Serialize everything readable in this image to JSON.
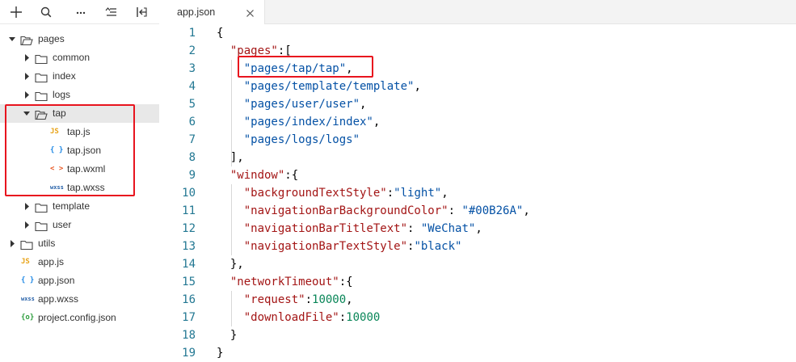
{
  "toolbar": {
    "buttons": [
      {
        "icon": "add-icon"
      },
      {
        "icon": "search-icon"
      },
      {
        "icon": "more-icon"
      },
      {
        "icon": "sort-icon"
      },
      {
        "icon": "collapse-icon"
      }
    ]
  },
  "tree": [
    {
      "label": "pages",
      "type": "folder",
      "expanded": true
    },
    {
      "label": "common",
      "type": "folder",
      "expanded": false
    },
    {
      "label": "index",
      "type": "folder",
      "expanded": false
    },
    {
      "label": "logs",
      "type": "folder",
      "expanded": false
    },
    {
      "label": "tap",
      "type": "folder",
      "expanded": true,
      "selected": true
    },
    {
      "label": "tap.js",
      "type": "file",
      "badge": "JS"
    },
    {
      "label": "tap.json",
      "type": "file",
      "badge": "{ }"
    },
    {
      "label": "tap.wxml",
      "type": "file",
      "badge": "< >"
    },
    {
      "label": "tap.wxss",
      "type": "file",
      "badge": "wxss"
    },
    {
      "label": "template",
      "type": "folder",
      "expanded": false
    },
    {
      "label": "user",
      "type": "folder",
      "expanded": false
    },
    {
      "label": "utils",
      "type": "folder",
      "expanded": false
    },
    {
      "label": "app.js",
      "type": "file",
      "badge": "JS"
    },
    {
      "label": "app.json",
      "type": "file",
      "badge": "{ }"
    },
    {
      "label": "app.wxss",
      "type": "file",
      "badge": "wxss"
    },
    {
      "label": "project.config.json",
      "type": "file",
      "badge": "{o}"
    }
  ],
  "tab": {
    "label": "app.json"
  },
  "code": {
    "line_numbers": [
      "1",
      "2",
      "3",
      "4",
      "5",
      "6",
      "7",
      "8",
      "9",
      "10",
      "11",
      "12",
      "13",
      "14",
      "15",
      "16",
      "17",
      "18",
      "19"
    ],
    "lines": [
      [
        {
          "t": "{",
          "c": "punc"
        }
      ],
      [
        {
          "t": "  ",
          "c": "punc"
        },
        {
          "t": "\"pages\"",
          "c": "key"
        },
        {
          "t": ":[",
          "c": "punc"
        }
      ],
      [
        {
          "t": "    ",
          "c": "punc"
        },
        {
          "t": "\"pages/tap/tap\"",
          "c": "str"
        },
        {
          "t": ",",
          "c": "punc"
        }
      ],
      [
        {
          "t": "    ",
          "c": "punc"
        },
        {
          "t": "\"pages/template/template\"",
          "c": "str"
        },
        {
          "t": ",",
          "c": "punc"
        }
      ],
      [
        {
          "t": "    ",
          "c": "punc"
        },
        {
          "t": "\"pages/user/user\"",
          "c": "str"
        },
        {
          "t": ",",
          "c": "punc"
        }
      ],
      [
        {
          "t": "    ",
          "c": "punc"
        },
        {
          "t": "\"pages/index/index\"",
          "c": "str"
        },
        {
          "t": ",",
          "c": "punc"
        }
      ],
      [
        {
          "t": "    ",
          "c": "punc"
        },
        {
          "t": "\"pages/logs/logs\"",
          "c": "str"
        }
      ],
      [
        {
          "t": "  ],",
          "c": "punc"
        }
      ],
      [
        {
          "t": "  ",
          "c": "punc"
        },
        {
          "t": "\"window\"",
          "c": "key"
        },
        {
          "t": ":{",
          "c": "punc"
        }
      ],
      [
        {
          "t": "    ",
          "c": "punc"
        },
        {
          "t": "\"backgroundTextStyle\"",
          "c": "key"
        },
        {
          "t": ":",
          "c": "punc"
        },
        {
          "t": "\"light\"",
          "c": "str"
        },
        {
          "t": ",",
          "c": "punc"
        }
      ],
      [
        {
          "t": "    ",
          "c": "punc"
        },
        {
          "t": "\"navigationBarBackgroundColor\"",
          "c": "key"
        },
        {
          "t": ": ",
          "c": "punc"
        },
        {
          "t": "\"#00B26A\"",
          "c": "str"
        },
        {
          "t": ",",
          "c": "punc"
        }
      ],
      [
        {
          "t": "    ",
          "c": "punc"
        },
        {
          "t": "\"navigationBarTitleText\"",
          "c": "key"
        },
        {
          "t": ": ",
          "c": "punc"
        },
        {
          "t": "\"WeChat\"",
          "c": "str"
        },
        {
          "t": ",",
          "c": "punc"
        }
      ],
      [
        {
          "t": "    ",
          "c": "punc"
        },
        {
          "t": "\"navigationBarTextStyle\"",
          "c": "key"
        },
        {
          "t": ":",
          "c": "punc"
        },
        {
          "t": "\"black\"",
          "c": "str"
        }
      ],
      [
        {
          "t": "  },",
          "c": "punc"
        }
      ],
      [
        {
          "t": "  ",
          "c": "punc"
        },
        {
          "t": "\"networkTimeout\"",
          "c": "key"
        },
        {
          "t": ":{",
          "c": "punc"
        }
      ],
      [
        {
          "t": "    ",
          "c": "punc"
        },
        {
          "t": "\"request\"",
          "c": "key"
        },
        {
          "t": ":",
          "c": "punc"
        },
        {
          "t": "10000",
          "c": "num"
        },
        {
          "t": ",",
          "c": "punc"
        }
      ],
      [
        {
          "t": "    ",
          "c": "punc"
        },
        {
          "t": "\"downloadFile\"",
          "c": "key"
        },
        {
          "t": ":",
          "c": "punc"
        },
        {
          "t": "10000",
          "c": "num"
        }
      ],
      [
        {
          "t": "  }",
          "c": "punc"
        }
      ],
      [
        {
          "t": "}",
          "c": "punc"
        }
      ]
    ]
  },
  "colors": {
    "key": "#a31515",
    "string": "#0451a5",
    "number": "#098658",
    "line_number": "#237893",
    "highlight": "#e8141e",
    "js_badge": "#e8a317",
    "json_badge": "#1e88e5",
    "wxml_badge": "#e8541e",
    "wxss_badge": "#2560a8",
    "config_badge": "#2e9e3e"
  }
}
